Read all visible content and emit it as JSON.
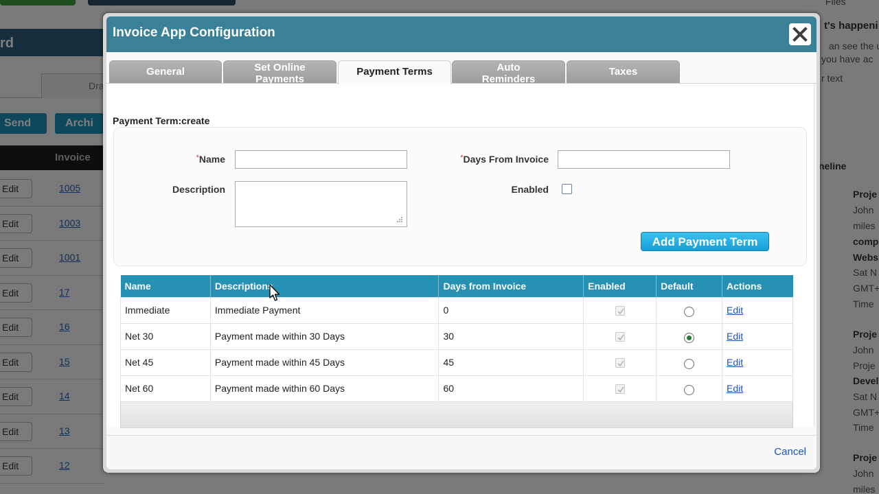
{
  "background": {
    "left_header": "rd",
    "left_tab_label": "Dra",
    "send_label": "Send",
    "archive_label": "Archi",
    "grid_header": "Invoice",
    "rows": [
      {
        "edit": "Edit",
        "number": "1005"
      },
      {
        "edit": "Edit",
        "number": "1003"
      },
      {
        "edit": "Edit",
        "number": "1001"
      },
      {
        "edit": "Edit",
        "number": "17"
      },
      {
        "edit": "Edit",
        "number": "16"
      },
      {
        "edit": "Edit",
        "number": "15"
      },
      {
        "edit": "Edit",
        "number": "14"
      },
      {
        "edit": "Edit",
        "number": "13"
      },
      {
        "edit": "Edit",
        "number": "12"
      }
    ],
    "right_panel": {
      "t1": "Files",
      "t2": "t's happeni",
      "t3": "an see the u",
      "t4": "you have ac",
      "t5": "r text",
      "t6": "neline",
      "t7": "Proje",
      "t8": "John",
      "t9": "miles",
      "t10": "comp",
      "t11": "Webs",
      "t12": "Sat N",
      "t13": "GMT+",
      "t14": "Time",
      "t15": "Proje",
      "t16": "John",
      "t17": "Proje",
      "t18": "Devel",
      "t19": "Sat N",
      "t20": "GMT+",
      "t21": "Time",
      "t22": "Proje",
      "t23": "John",
      "t24": "miles"
    }
  },
  "dialog": {
    "title": "Invoice App Configuration",
    "tabs": [
      {
        "label_line1": "General",
        "label_line2": ""
      },
      {
        "label_line1": "Set Online",
        "label_line2": "Payments"
      },
      {
        "label_line1": "Payment Terms",
        "label_line2": ""
      },
      {
        "label_line1": "Auto",
        "label_line2": "Reminders"
      },
      {
        "label_line1": "Taxes",
        "label_line2": ""
      }
    ],
    "active_tab": "Payment Terms",
    "form": {
      "title": "Payment Term:create",
      "required_mark": "*",
      "name_label": "Name",
      "name_value": "",
      "days_label": "Days From Invoice",
      "days_value": "",
      "description_label": "Description",
      "description_value": "",
      "enabled_label": "Enabled",
      "enabled_checked": false,
      "add_button": "Add Payment Term"
    },
    "table": {
      "headers": [
        "Name",
        "Descriptions",
        "Days from Invoice",
        "Enabled",
        "Default",
        "Actions"
      ],
      "rows": [
        {
          "name": "Immediate",
          "description": "Immediate Payment",
          "days": "0",
          "enabled": true,
          "default": false,
          "action": "Edit"
        },
        {
          "name": "Net 30",
          "description": "Payment made within 30 Days",
          "days": "30",
          "enabled": true,
          "default": true,
          "action": "Edit"
        },
        {
          "name": "Net 45",
          "description": "Payment made within 45 Days",
          "days": "45",
          "enabled": true,
          "default": false,
          "action": "Edit"
        },
        {
          "name": "Net 60",
          "description": "Payment made within 60 Days",
          "days": "60",
          "enabled": true,
          "default": false,
          "action": "Edit"
        }
      ]
    },
    "cancel_label": "Cancel"
  },
  "icons": {
    "close": "close-icon",
    "checkmark": "checkmark-icon",
    "cursor": "mouse-cursor-icon",
    "resize_grip": "resize-grip-icon"
  },
  "colors": {
    "header": "#3a8096",
    "table_header": "#2791b4",
    "primary_button": "#169fd6",
    "link": "#1a53c4"
  }
}
